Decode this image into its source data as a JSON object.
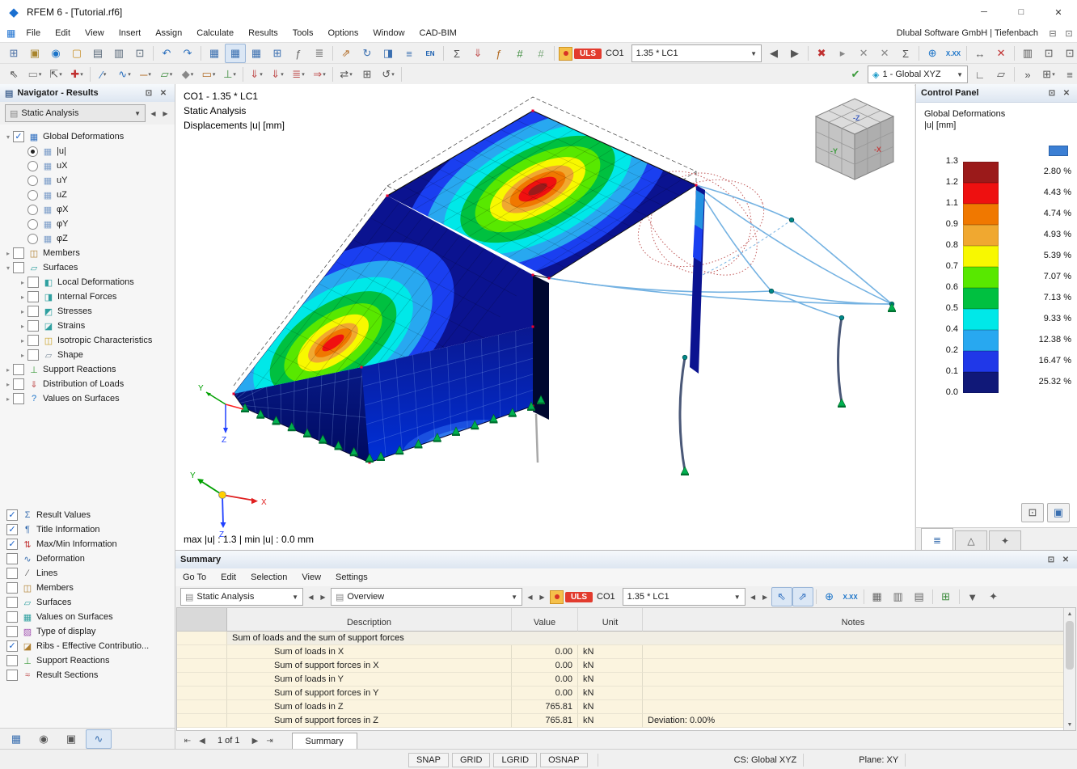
{
  "window": {
    "title": "RFEM 6 - [Tutorial.rf6]",
    "brand": "Dlubal Software GmbH | Tiefenbach"
  },
  "menu": [
    "File",
    "Edit",
    "View",
    "Insert",
    "Assign",
    "Calculate",
    "Results",
    "Tools",
    "Options",
    "Window",
    "CAD-BIM"
  ],
  "toolbar1": {
    "pre": [
      {
        "n": "new-model",
        "g": "⊞",
        "c": "#4a6fa5"
      },
      {
        "n": "paste",
        "g": "▣",
        "c": "#a8842c"
      },
      {
        "n": "web-service",
        "g": "◉",
        "c": "#1a73c8"
      },
      {
        "n": "open-file",
        "g": "▢",
        "c": "#c89028"
      },
      {
        "n": "save",
        "g": "▤",
        "c": "#5a6a7a"
      },
      {
        "n": "print",
        "g": "▥",
        "c": "#5a6a7a"
      },
      {
        "n": "copy",
        "g": "⊡",
        "c": "#5a6a7a"
      },
      {
        "sep": true
      },
      {
        "n": "undo",
        "g": "↶",
        "c": "#2a6fbd"
      },
      {
        "n": "redo",
        "g": "↷",
        "c": "#2a6fbd"
      },
      {
        "sep": true
      },
      {
        "n": "table-data",
        "g": "▦",
        "c": "#3a6fb0"
      },
      {
        "n": "table-results",
        "g": "▦",
        "c": "#3a6fb0",
        "a": true
      },
      {
        "n": "table-printout",
        "g": "▦",
        "c": "#3a6fb0"
      },
      {
        "n": "spreadsheet",
        "g": "⊞",
        "c": "#3a6fb0"
      },
      {
        "n": "sc-tool",
        "g": "ƒ",
        "c": "#666666"
      },
      {
        "n": "report",
        "g": "≣",
        "c": "#666666"
      },
      {
        "sep": true
      },
      {
        "n": "transform-move",
        "g": "⇗",
        "c": "#b06820"
      },
      {
        "n": "transform-rotate",
        "g": "↻",
        "c": "#3a6fb0"
      },
      {
        "n": "transform-mirror",
        "g": "◨",
        "c": "#3a6fb0"
      },
      {
        "n": "align",
        "g": "≡",
        "c": "#3a6fb0"
      },
      {
        "n": "standard-en",
        "g": "EN",
        "c": "#1a5fb0",
        "t": true
      },
      {
        "sep": true
      },
      {
        "n": "calculate-all",
        "g": "Σ",
        "c": "#555555"
      },
      {
        "n": "load-cases",
        "g": "⇓",
        "c": "#c05050"
      },
      {
        "n": "combinations",
        "g": "ƒ",
        "c": "#b06820"
      },
      {
        "n": "mesh-generate",
        "g": "#",
        "c": "#3a8a3a"
      },
      {
        "n": "mesh-settings",
        "g": "#",
        "c": "#7aa87a"
      },
      {
        "sep": true
      }
    ],
    "uls": "ULS",
    "co": "CO1",
    "combo": "1.35 * LC1",
    "post": [
      {
        "n": "prev-combo",
        "g": "◀",
        "c": "#555555"
      },
      {
        "n": "next-combo",
        "g": "▶",
        "c": "#555555"
      },
      {
        "sep": true
      },
      {
        "n": "delete-results",
        "g": "✖",
        "c": "#c03030"
      },
      {
        "n": "results-menu",
        "g": "▸",
        "c": "#888888"
      },
      {
        "n": "values-x1",
        "g": "✕",
        "c": "#888888"
      },
      {
        "n": "values-x2",
        "g": "✕",
        "c": "#888888"
      },
      {
        "n": "user-defined-values",
        "g": "Σ",
        "c": "#555555"
      },
      {
        "sep": true
      },
      {
        "n": "zoom-results",
        "g": "⊕",
        "c": "#1a73c8"
      },
      {
        "n": "result-values-xxx",
        "g": "X.XX",
        "c": "#1a73c8",
        "t": true
      },
      {
        "sep": true
      },
      {
        "n": "dimension",
        "g": "↔",
        "c": "#555555"
      },
      {
        "n": "cut-section",
        "g": "✕",
        "c": "#c03030"
      },
      {
        "sep": true
      },
      {
        "n": "print-graphic",
        "g": "▥",
        "c": "#555555"
      },
      {
        "n": "frame-1",
        "g": "⊡",
        "c": "#555555"
      },
      {
        "n": "frame-2",
        "g": "⊡",
        "c": "#555555"
      }
    ]
  },
  "toolbar2": {
    "pre": [
      {
        "n": "select-pointer",
        "g": "⇖",
        "c": "#444444"
      },
      {
        "n": "select-box",
        "g": "▭",
        "c": "#888888",
        "v": true
      },
      {
        "n": "select-special",
        "g": "⇱",
        "c": "#555555",
        "v": true
      },
      {
        "n": "node-new",
        "g": "✚",
        "c": "#c03030",
        "v": true
      },
      {
        "sep": true
      },
      {
        "n": "line-new",
        "g": "∕",
        "c": "#2a6fbd",
        "v": true
      },
      {
        "n": "curve-new",
        "g": "∿",
        "c": "#2a6fbd",
        "v": true
      },
      {
        "n": "member-new",
        "g": "─",
        "c": "#b06820",
        "v": true
      },
      {
        "n": "surface-new",
        "g": "▱",
        "c": "#3a8a3a",
        "v": true
      },
      {
        "n": "solid-new",
        "g": "◆",
        "c": "#888888",
        "v": true
      },
      {
        "n": "opening-new",
        "g": "▭",
        "c": "#b06820",
        "v": true
      },
      {
        "n": "support-new",
        "g": "⊥",
        "c": "#3a8a3a",
        "v": true
      },
      {
        "sep": true
      },
      {
        "n": "load-node",
        "g": "⇓",
        "c": "#c05050",
        "v": true
      },
      {
        "n": "load-member",
        "g": "⇓",
        "c": "#c05050",
        "v": true
      },
      {
        "n": "load-surface",
        "g": "≣",
        "c": "#c05050",
        "v": true
      },
      {
        "n": "load-free",
        "g": "⇒",
        "c": "#c05050",
        "v": true
      },
      {
        "sep": true
      },
      {
        "n": "edit-move",
        "g": "⇄",
        "c": "#555555",
        "v": true
      },
      {
        "n": "edit-copy",
        "g": "⊞",
        "c": "#555555"
      },
      {
        "n": "edit-rotate",
        "g": "↺",
        "c": "#555555",
        "v": true
      },
      {
        "sep": true
      }
    ],
    "check_name": "model-check",
    "combo": "1 - Global XYZ",
    "post": [
      {
        "n": "work-plane",
        "g": "∟",
        "c": "#555555"
      },
      {
        "n": "plane-grid",
        "g": "▱",
        "c": "#555555"
      },
      {
        "sep": true
      },
      {
        "n": "more-tools",
        "g": "»",
        "c": "#555555"
      },
      {
        "n": "new-window",
        "g": "⊞",
        "c": "#555555",
        "v": true
      },
      {
        "n": "window-list",
        "g": "≡",
        "c": "#555555"
      }
    ]
  },
  "navigator": {
    "title": "Navigator - Results",
    "combo": "Static Analysis",
    "tree": [
      {
        "label": "Global Deformations",
        "depth": 0,
        "caret": "exp",
        "check": true,
        "ic": "▦",
        "icc": "#2f6fc0"
      },
      {
        "label": "|u|",
        "depth": 1,
        "radio": true,
        "sel": true,
        "ic": "▦",
        "icc": "#7a9cc8"
      },
      {
        "label": "uX",
        "depth": 1,
        "radio": true,
        "ic": "▦",
        "icc": "#7a9cc8"
      },
      {
        "label": "uY",
        "depth": 1,
        "radio": true,
        "ic": "▦",
        "icc": "#7a9cc8"
      },
      {
        "label": "uZ",
        "depth": 1,
        "radio": true,
        "ic": "▦",
        "icc": "#7a9cc8"
      },
      {
        "label": "φX",
        "depth": 1,
        "radio": true,
        "ic": "▦",
        "icc": "#7a9cc8"
      },
      {
        "label": "φY",
        "depth": 1,
        "radio": true,
        "ic": "▦",
        "icc": "#7a9cc8"
      },
      {
        "label": "φZ",
        "depth": 1,
        "radio": true,
        "ic": "▦",
        "icc": "#7a9cc8"
      },
      {
        "label": "Members",
        "depth": 0,
        "caret": "col",
        "check": false,
        "ic": "◫",
        "icc": "#b08030"
      },
      {
        "label": "Surfaces",
        "depth": 0,
        "caret": "exp",
        "check": false,
        "ic": "▱",
        "icc": "#2fa0a0"
      },
      {
        "label": "Local Deformations",
        "depth": 1,
        "caret": "col",
        "check": false,
        "ic": "◧",
        "icc": "#2fa0a0"
      },
      {
        "label": "Internal Forces",
        "depth": 1,
        "caret": "col",
        "check": false,
        "ic": "◨",
        "icc": "#2fa0a0"
      },
      {
        "label": "Stresses",
        "depth": 1,
        "caret": "col",
        "check": false,
        "ic": "◩",
        "icc": "#2fa0a0"
      },
      {
        "label": "Strains",
        "depth": 1,
        "caret": "col",
        "check": false,
        "ic": "◪",
        "icc": "#2fa0a0"
      },
      {
        "label": "Isotropic Characteristics",
        "depth": 1,
        "caret": "col",
        "check": false,
        "ic": "◫",
        "icc": "#c8a020"
      },
      {
        "label": "Shape",
        "depth": 1,
        "caret": "col",
        "check": false,
        "ic": "▱",
        "icc": "#8090a0"
      },
      {
        "label": "Support Reactions",
        "depth": 0,
        "caret": "col",
        "check": false,
        "ic": "⊥",
        "icc": "#3a9a3a"
      },
      {
        "label": "Distribution of Loads",
        "depth": 0,
        "caret": "col",
        "check": false,
        "ic": "⇓",
        "icc": "#c05050"
      },
      {
        "label": "Values on Surfaces",
        "depth": 0,
        "caret": "col",
        "check": false,
        "ic": "?",
        "icc": "#1a73c8"
      }
    ],
    "lower": [
      {
        "label": "Result Values",
        "check": true,
        "ic": "Σ",
        "icc": "#3a6fb0"
      },
      {
        "label": "Title Information",
        "check": true,
        "ic": "¶",
        "icc": "#3a6fb0"
      },
      {
        "label": "Max/Min Information",
        "check": true,
        "ic": "⇅",
        "icc": "#c03030"
      },
      {
        "label": "Deformation",
        "check": false,
        "ic": "∿",
        "icc": "#3a6fb0"
      },
      {
        "label": "Lines",
        "check": false,
        "ic": "∕",
        "icc": "#555555"
      },
      {
        "label": "Members",
        "check": false,
        "ic": "◫",
        "icc": "#b08030"
      },
      {
        "label": "Surfaces",
        "check": false,
        "ic": "▱",
        "icc": "#2fa0a0"
      },
      {
        "label": "Values on Surfaces",
        "check": false,
        "ic": "▦",
        "icc": "#2fa0a0"
      },
      {
        "label": "Type of display",
        "check": false,
        "ic": "▨",
        "icc": "#a050b0"
      },
      {
        "label": "Ribs - Effective Contributio...",
        "check": true,
        "ic": "◪",
        "icc": "#b08030"
      },
      {
        "label": "Support Reactions",
        "check": false,
        "ic": "⊥",
        "icc": "#3a9a3a"
      },
      {
        "label": "Result Sections",
        "check": false,
        "ic": "≈",
        "icc": "#c05050"
      }
    ],
    "tabs": [
      {
        "n": "data-navigator-tab",
        "g": "▦",
        "c": "#3a6fb0"
      },
      {
        "n": "display-navigator-tab",
        "g": "◉",
        "c": "#555555"
      },
      {
        "n": "views-navigator-tab",
        "g": "▣",
        "c": "#555555"
      },
      {
        "n": "results-navigator-tab",
        "g": "∿",
        "c": "#3a6fb0",
        "a": true
      }
    ]
  },
  "viewport": {
    "header": [
      "CO1 - 1.35 * LC1",
      "Static Analysis",
      "Displacements |u| [mm]"
    ],
    "footer": "max |u| : 1.3 | min |u| : 0.0 mm"
  },
  "control_panel": {
    "title": "Control Panel",
    "subtitle1": "Global Deformations",
    "subtitle2": "|u| [mm]",
    "boundaries": [
      "1.3",
      "1.2",
      "1.1",
      "0.9",
      "0.8",
      "0.7",
      "0.6",
      "0.5",
      "0.4",
      "0.2",
      "0.1",
      "0.0"
    ],
    "bands": [
      {
        "color": "#9b1a1a",
        "pct": "2.80 %"
      },
      {
        "color": "#ee1010",
        "pct": "4.43 %"
      },
      {
        "color": "#f07800",
        "pct": "4.74 %"
      },
      {
        "color": "#f0a830",
        "pct": "4.93 %"
      },
      {
        "color": "#f8f800",
        "pct": "5.39 %"
      },
      {
        "color": "#58e800",
        "pct": "7.07 %"
      },
      {
        "color": "#00c040",
        "pct": "7.13 %"
      },
      {
        "color": "#00e8e8",
        "pct": "9.33 %"
      },
      {
        "color": "#28a8f0",
        "pct": "12.38 %"
      },
      {
        "color": "#2038e8",
        "pct": "16.47 %"
      },
      {
        "color": "#101878",
        "pct": "25.32 %"
      }
    ],
    "tabs": [
      {
        "n": "color-scale-tab",
        "g": "≣",
        "c": "#3a6fb0",
        "a": true
      },
      {
        "n": "factors-tab",
        "g": "△",
        "c": "#555555"
      },
      {
        "n": "filter-tab",
        "g": "✦",
        "c": "#555555"
      }
    ]
  },
  "summary": {
    "title": "Summary",
    "menu": [
      "Go To",
      "Edit",
      "Selection",
      "View",
      "Settings"
    ],
    "combo1": "Static Analysis",
    "combo2": "Overview",
    "uls": "ULS",
    "co": "CO1",
    "combo3": "1.35 * LC1",
    "icons": [
      {
        "n": "sync-selection",
        "g": "⇖",
        "c": "#2f6fc0",
        "a": true
      },
      {
        "n": "sync-view",
        "g": "⇗",
        "c": "#2f6fc0",
        "a": true
      },
      {
        "sep": true
      },
      {
        "n": "zoom-values",
        "g": "⊕",
        "c": "#1a73c8"
      },
      {
        "n": "values-xxx",
        "g": "X.XX",
        "c": "#1a73c8",
        "t": true
      },
      {
        "sep": true
      },
      {
        "n": "table-view-1",
        "g": "▦",
        "c": "#666666"
      },
      {
        "n": "table-view-2",
        "g": "▥",
        "c": "#666666"
      },
      {
        "n": "table-view-3",
        "g": "▤",
        "c": "#666666"
      },
      {
        "sep": true
      },
      {
        "n": "export-table",
        "g": "⊞",
        "c": "#3a8a3a"
      },
      {
        "sep": true
      },
      {
        "n": "filter-rows",
        "g": "▼",
        "c": "#555555"
      },
      {
        "n": "table-settings",
        "g": "✦",
        "c": "#555555"
      }
    ],
    "table": {
      "headers": [
        "Description",
        "Value",
        "Unit",
        "Notes"
      ],
      "section": "Sum of loads and the sum of support forces",
      "rows": [
        {
          "d": "Sum of loads in X",
          "v": "0.00",
          "u": "kN",
          "n": ""
        },
        {
          "d": "Sum of support forces in X",
          "v": "0.00",
          "u": "kN",
          "n": ""
        },
        {
          "d": "Sum of loads in Y",
          "v": "0.00",
          "u": "kN",
          "n": ""
        },
        {
          "d": "Sum of support forces in Y",
          "v": "0.00",
          "u": "kN",
          "n": ""
        },
        {
          "d": "Sum of loads in Z",
          "v": "765.81",
          "u": "kN",
          "n": ""
        },
        {
          "d": "Sum of support forces in Z",
          "v": "765.81",
          "u": "kN",
          "n": "Deviation: 0.00%"
        }
      ]
    },
    "pager": "1 of 1",
    "tab": "Summary"
  },
  "statusbar": {
    "buttons": [
      "SNAP",
      "GRID",
      "LGRID",
      "OSNAP"
    ],
    "cs": "CS: Global XYZ",
    "plane": "Plane: XY"
  }
}
